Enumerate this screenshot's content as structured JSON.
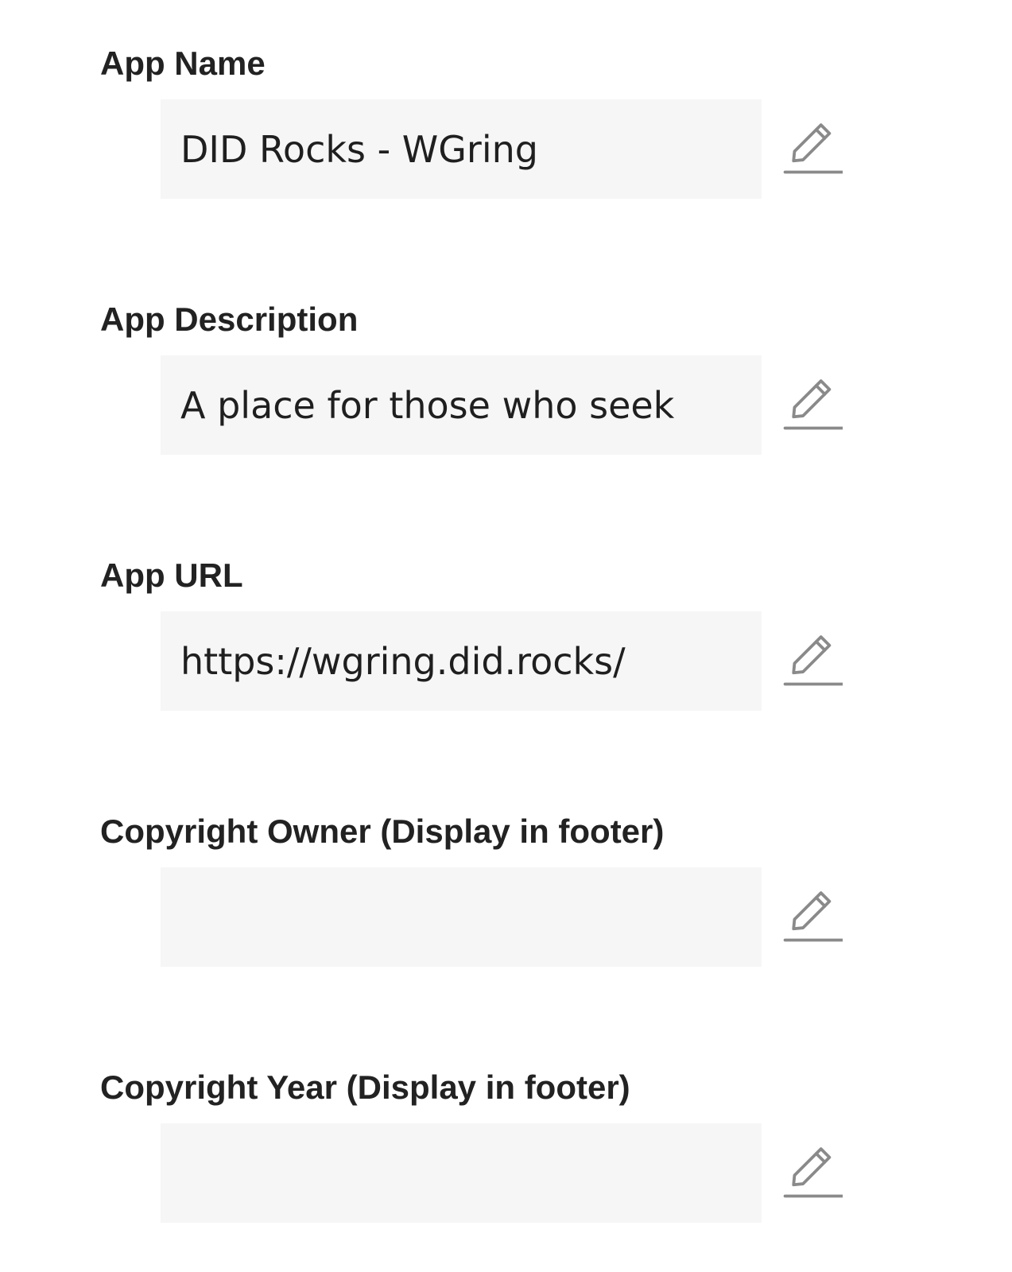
{
  "fields": [
    {
      "label": "App Name",
      "value": "DID Rocks - WGring",
      "edit_icon": "pencil-edit-icon"
    },
    {
      "label": "App Description",
      "value": "A place for those who seek",
      "edit_icon": "pencil-edit-icon"
    },
    {
      "label": "App URL",
      "value": "https://wgring.did.rocks/",
      "edit_icon": "pencil-edit-icon"
    },
    {
      "label": "Copyright Owner (Display in footer)",
      "value": "",
      "edit_icon": "pencil-edit-icon"
    },
    {
      "label": "Copyright Year (Display in footer)",
      "value": "",
      "edit_icon": "pencil-edit-icon"
    }
  ],
  "colors": {
    "label_text": "#222222",
    "value_text": "#1f1f1f",
    "field_background": "#f6f6f6",
    "icon_stroke": "#8a8a8a"
  }
}
